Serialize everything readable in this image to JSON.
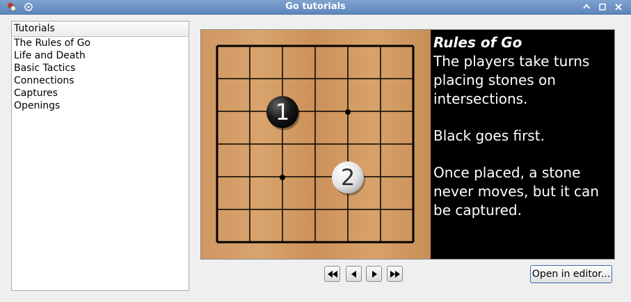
{
  "window": {
    "title": "Go tutorials"
  },
  "sidebar": {
    "header": "Tutorials",
    "items": [
      "The Rules of Go",
      "Life and Death",
      "Basic Tactics",
      "Connections",
      "Captures",
      "Openings"
    ]
  },
  "tutorial": {
    "heading": "Rules of Go",
    "paragraphs": [
      "The players take turns placing stones on intersections.",
      "Black goes first.",
      "Once placed, a stone never moves, but it can be captured."
    ]
  },
  "board": {
    "grid_lines": 7,
    "stones": [
      {
        "color": "black",
        "label": "1"
      },
      {
        "color": "white",
        "label": "2"
      }
    ]
  },
  "navigation": {
    "buttons": [
      "first-icon",
      "previous-icon",
      "next-icon",
      "last-icon"
    ]
  },
  "actions": {
    "open_editor": "Open in editor..."
  }
}
